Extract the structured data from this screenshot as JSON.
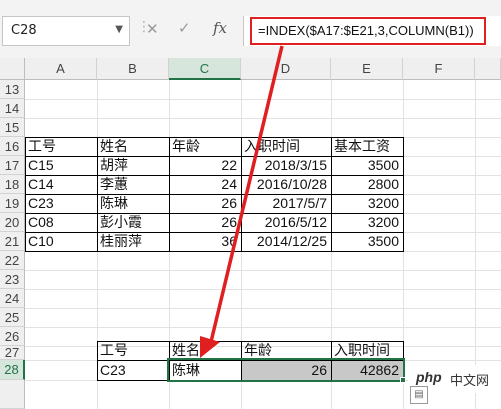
{
  "formula_bar": {
    "name_box": "C28",
    "formula": "=INDEX($A17:$E21,3,COLUMN(B1))",
    "fx_label": "fx"
  },
  "columns": [
    "A",
    "B",
    "C",
    "D",
    "E",
    "F"
  ],
  "rows": [
    "13",
    "14",
    "15",
    "16",
    "17",
    "18",
    "19",
    "20",
    "21",
    "22",
    "23",
    "24",
    "25",
    "26",
    "27",
    "28"
  ],
  "table1": {
    "headers": [
      "工号",
      "姓名",
      "年龄",
      "入职时间",
      "基本工资"
    ],
    "rows": [
      [
        "C15",
        "胡萍",
        "22",
        "2018/3/15",
        "3500"
      ],
      [
        "C14",
        "李蕙",
        "24",
        "2016/10/28",
        "2800"
      ],
      [
        "C23",
        "陈琳",
        "26",
        "2017/5/7",
        "3200"
      ],
      [
        "C08",
        "彭小霞",
        "26",
        "2016/5/12",
        "3200"
      ],
      [
        "C10",
        "桂丽萍",
        "36",
        "2014/12/25",
        "3500"
      ]
    ]
  },
  "table2": {
    "headers": [
      "工号",
      "姓名",
      "年龄",
      "入职时间"
    ],
    "row": [
      "C23",
      "陈琳",
      "26",
      "42862"
    ]
  },
  "watermark": {
    "php": "php",
    "cn": "中文网"
  },
  "colors": {
    "accent": "#217346",
    "highlight": "#e02020"
  }
}
